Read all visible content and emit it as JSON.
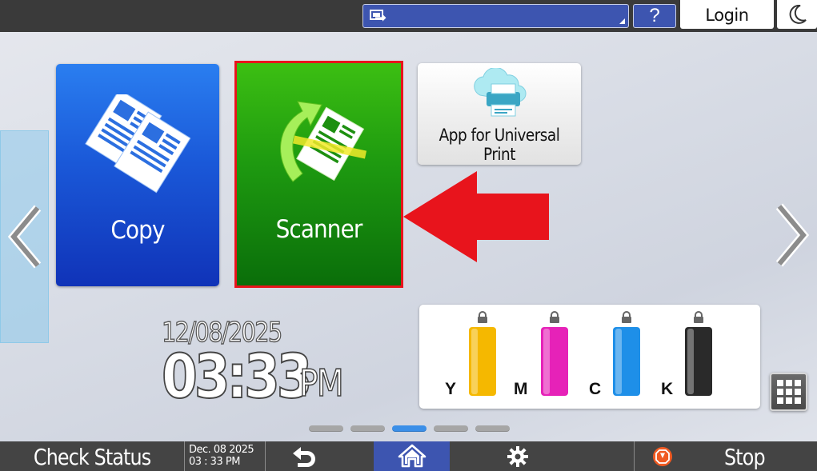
{
  "topbar": {
    "input_source_icon": "input-source-icon",
    "help_label": "?",
    "login_label": "Login",
    "night_mode_icon": "moon-icon"
  },
  "tiles": {
    "copy": {
      "label": "Copy",
      "icon": "copy-documents-icon",
      "color": "#1a58d8"
    },
    "scanner": {
      "label": "Scanner",
      "icon": "scanner-document-icon",
      "color": "#1e9a10",
      "highlight_color": "#e8141c"
    },
    "universal_print": {
      "label": "App for Universal Print",
      "icon": "cloud-printer-icon"
    }
  },
  "annotation": {
    "pointer_color": "#e8141c"
  },
  "clock": {
    "date": "12/08/2025",
    "time": "03:33",
    "ampm": "PM"
  },
  "toners": [
    {
      "letter": "Y",
      "color": "#f5b800",
      "level": 1.0
    },
    {
      "letter": "M",
      "color": "#e622b8",
      "level": 1.0
    },
    {
      "letter": "C",
      "color": "#1e8fe8",
      "level": 1.0
    },
    {
      "letter": "K",
      "color": "#2a2a2a",
      "level": 1.0
    }
  ],
  "page_indicator": {
    "count": 5,
    "active": 3
  },
  "bottombar": {
    "check_status_label": "Check Status",
    "status_date": "Dec. 08 2025",
    "status_time": "03 : 33 PM",
    "back_icon": "back-arrow-icon",
    "home_icon": "home-icon",
    "settings_icon": "gear-icon",
    "stop_icon": "stop-icon",
    "stop_label": "Stop"
  }
}
